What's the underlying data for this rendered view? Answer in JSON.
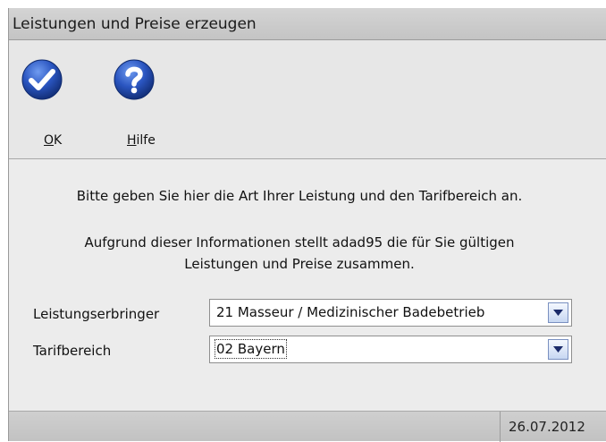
{
  "window": {
    "title": "Leistungen und Preise erzeugen"
  },
  "toolbar": {
    "ok": {
      "label_prefix": "",
      "label_accel": "O",
      "label_rest": "K",
      "icon": "checkmark-icon"
    },
    "help": {
      "label_prefix": "",
      "label_accel": "H",
      "label_rest": "ilfe",
      "icon": "question-mark-icon"
    }
  },
  "content": {
    "info_line1": "Bitte geben Sie hier die Art Ihrer Leistung und den Tarifbereich an.",
    "info_line2": "Aufgrund dieser Informationen stellt adad95 die für Sie gültigen",
    "info_line3": "Leistungen und Preise zusammen.",
    "provider_label": "Leistungserbringer",
    "provider_value": "21 Masseur / Medizinischer Badebetrieb",
    "tariff_label": "Tarifbereich",
    "tariff_value": "02 Bayern"
  },
  "statusbar": {
    "date": "26.07.2012"
  },
  "colors": {
    "icon_blue": "#1f4fb0",
    "dropdown_arrow": "#1a2a6a"
  }
}
